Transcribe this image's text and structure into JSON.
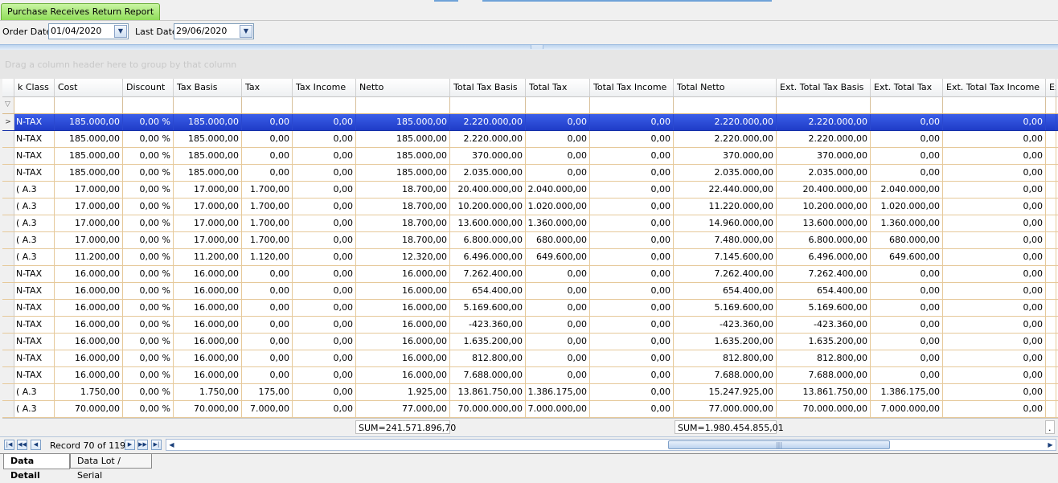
{
  "report_tab": "Purchase Receives Return Report",
  "filters": {
    "order_date_label": "Order Date",
    "order_date": "01/04/2020",
    "last_date_label": "Last Date",
    "last_date": "29/06/2020"
  },
  "group_hint": "Drag a column header here to group by that column",
  "columns": [
    "k Class",
    "Cost",
    "Discount",
    "Tax Basis",
    "Tax",
    "Tax Income",
    "Netto",
    "Total Tax Basis",
    "Total Tax",
    "Total Tax Income",
    "Total Netto",
    "Ext. Total Tax Basis",
    "Ext. Total Tax",
    "Ext. Total Tax Income",
    "Ex"
  ],
  "rows": [
    [
      "N-TAX",
      "185.000,00",
      "0,00 %",
      "185.000,00",
      "0,00",
      "0,00",
      "185.000,00",
      "2.220.000,00",
      "0,00",
      "0,00",
      "2.220.000,00",
      "2.220.000,00",
      "0,00",
      "0,00"
    ],
    [
      "N-TAX",
      "185.000,00",
      "0,00 %",
      "185.000,00",
      "0,00",
      "0,00",
      "185.000,00",
      "2.220.000,00",
      "0,00",
      "0,00",
      "2.220.000,00",
      "2.220.000,00",
      "0,00",
      "0,00"
    ],
    [
      "N-TAX",
      "185.000,00",
      "0,00 %",
      "185.000,00",
      "0,00",
      "0,00",
      "185.000,00",
      "370.000,00",
      "0,00",
      "0,00",
      "370.000,00",
      "370.000,00",
      "0,00",
      "0,00"
    ],
    [
      "N-TAX",
      "185.000,00",
      "0,00 %",
      "185.000,00",
      "0,00",
      "0,00",
      "185.000,00",
      "2.035.000,00",
      "0,00",
      "0,00",
      "2.035.000,00",
      "2.035.000,00",
      "0,00",
      "0,00"
    ],
    [
      "( A.3",
      "17.000,00",
      "0,00 %",
      "17.000,00",
      "1.700,00",
      "0,00",
      "18.700,00",
      "20.400.000,00",
      "2.040.000,00",
      "0,00",
      "22.440.000,00",
      "20.400.000,00",
      "2.040.000,00",
      "0,00"
    ],
    [
      "( A.3",
      "17.000,00",
      "0,00 %",
      "17.000,00",
      "1.700,00",
      "0,00",
      "18.700,00",
      "10.200.000,00",
      "1.020.000,00",
      "0,00",
      "11.220.000,00",
      "10.200.000,00",
      "1.020.000,00",
      "0,00"
    ],
    [
      "( A.3",
      "17.000,00",
      "0,00 %",
      "17.000,00",
      "1.700,00",
      "0,00",
      "18.700,00",
      "13.600.000,00",
      "1.360.000,00",
      "0,00",
      "14.960.000,00",
      "13.600.000,00",
      "1.360.000,00",
      "0,00"
    ],
    [
      "( A.3",
      "17.000,00",
      "0,00 %",
      "17.000,00",
      "1.700,00",
      "0,00",
      "18.700,00",
      "6.800.000,00",
      "680.000,00",
      "0,00",
      "7.480.000,00",
      "6.800.000,00",
      "680.000,00",
      "0,00"
    ],
    [
      "( A.3",
      "11.200,00",
      "0,00 %",
      "11.200,00",
      "1.120,00",
      "0,00",
      "12.320,00",
      "6.496.000,00",
      "649.600,00",
      "0,00",
      "7.145.600,00",
      "6.496.000,00",
      "649.600,00",
      "0,00"
    ],
    [
      "N-TAX",
      "16.000,00",
      "0,00 %",
      "16.000,00",
      "0,00",
      "0,00",
      "16.000,00",
      "7.262.400,00",
      "0,00",
      "0,00",
      "7.262.400,00",
      "7.262.400,00",
      "0,00",
      "0,00"
    ],
    [
      "N-TAX",
      "16.000,00",
      "0,00 %",
      "16.000,00",
      "0,00",
      "0,00",
      "16.000,00",
      "654.400,00",
      "0,00",
      "0,00",
      "654.400,00",
      "654.400,00",
      "0,00",
      "0,00"
    ],
    [
      "N-TAX",
      "16.000,00",
      "0,00 %",
      "16.000,00",
      "0,00",
      "0,00",
      "16.000,00",
      "5.169.600,00",
      "0,00",
      "0,00",
      "5.169.600,00",
      "5.169.600,00",
      "0,00",
      "0,00"
    ],
    [
      "N-TAX",
      "16.000,00",
      "0,00 %",
      "16.000,00",
      "0,00",
      "0,00",
      "16.000,00",
      "-423.360,00",
      "0,00",
      "0,00",
      "-423.360,00",
      "-423.360,00",
      "0,00",
      "0,00"
    ],
    [
      "N-TAX",
      "16.000,00",
      "0,00 %",
      "16.000,00",
      "0,00",
      "0,00",
      "16.000,00",
      "1.635.200,00",
      "0,00",
      "0,00",
      "1.635.200,00",
      "1.635.200,00",
      "0,00",
      "0,00"
    ],
    [
      "N-TAX",
      "16.000,00",
      "0,00 %",
      "16.000,00",
      "0,00",
      "0,00",
      "16.000,00",
      "812.800,00",
      "0,00",
      "0,00",
      "812.800,00",
      "812.800,00",
      "0,00",
      "0,00"
    ],
    [
      "N-TAX",
      "16.000,00",
      "0,00 %",
      "16.000,00",
      "0,00",
      "0,00",
      "16.000,00",
      "7.688.000,00",
      "0,00",
      "0,00",
      "7.688.000,00",
      "7.688.000,00",
      "0,00",
      "0,00"
    ],
    [
      "( A.3",
      "1.750,00",
      "0,00 %",
      "1.750,00",
      "175,00",
      "0,00",
      "1.925,00",
      "13.861.750,00",
      "1.386.175,00",
      "0,00",
      "15.247.925,00",
      "13.861.750,00",
      "1.386.175,00",
      "0,00"
    ],
    [
      "( A.3",
      "70.000,00",
      "0,00 %",
      "70.000,00",
      "7.000,00",
      "0,00",
      "77.000,00",
      "70.000.000,00",
      "7.000.000,00",
      "0,00",
      "77.000.000,00",
      "70.000.000,00",
      "7.000.000,00",
      "0,00"
    ]
  ],
  "sums": {
    "netto": "SUM=241.571.896,70",
    "total_netto": "SUM=1.980.454.855,01",
    "dot": "."
  },
  "navigator": {
    "record_text": "Record 70 of 119"
  },
  "bottom_tabs": [
    "Data Detail",
    "Data Lot / Serial"
  ]
}
